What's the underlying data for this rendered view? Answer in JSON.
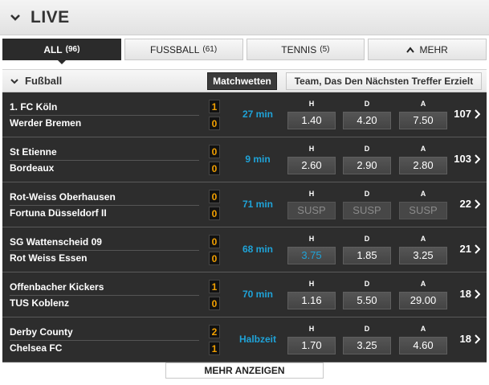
{
  "header": {
    "title": "LIVE"
  },
  "tabs": [
    {
      "label": "ALL",
      "count": "(96)",
      "active": true
    },
    {
      "label": "FUSSBALL",
      "count": "(61)"
    },
    {
      "label": "TENNIS",
      "count": "(5)"
    },
    {
      "label": "MEHR",
      "count": ""
    }
  ],
  "section": {
    "title": "Fußball",
    "market_active": "Matchwetten",
    "market_other": "Team, Das Den Nächsten Treffer Erzielt"
  },
  "odds_labels": {
    "h": "H",
    "d": "D",
    "a": "A"
  },
  "matches": [
    {
      "home": "1. FC Köln",
      "away": "Werder Bremen",
      "score_home": "1",
      "score_away": "0",
      "time": "27 min",
      "h": "1.40",
      "d": "4.20",
      "a": "7.50",
      "more": "107"
    },
    {
      "home": "St Etienne",
      "away": "Bordeaux",
      "score_home": "0",
      "score_away": "0",
      "time": "9 min",
      "h": "2.60",
      "d": "2.90",
      "a": "2.80",
      "more": "103"
    },
    {
      "home": "Rot-Weiss Oberhausen",
      "away": "Fortuna Düsseldorf II",
      "score_home": "0",
      "score_away": "0",
      "time": "71 min",
      "h": "SUSP",
      "d": "SUSP",
      "a": "SUSP",
      "more": "22",
      "suspended": true
    },
    {
      "home": "SG Wattenscheid 09",
      "away": "Rot Weiss Essen",
      "score_home": "0",
      "score_away": "0",
      "time": "68 min",
      "h": "3.75",
      "d": "1.85",
      "a": "3.25",
      "more": "21",
      "h_changed": true
    },
    {
      "home": "Offenbacher Kickers",
      "away": "TUS Koblenz",
      "score_home": "1",
      "score_away": "0",
      "time": "70 min",
      "h": "1.16",
      "d": "5.50",
      "a": "29.00",
      "more": "18"
    },
    {
      "home": "Derby County",
      "away": "Chelsea FC",
      "score_home": "2",
      "score_away": "1",
      "time": "Halbzeit",
      "h": "1.70",
      "d": "3.25",
      "a": "4.60",
      "more": "18"
    }
  ],
  "footer": {
    "more_label": "MEHR ANZEIGEN"
  },
  "colors": {
    "accent_blue": "#1fa3d8",
    "score_orange": "#f2a000",
    "row_bg": "#2d2d2d"
  }
}
